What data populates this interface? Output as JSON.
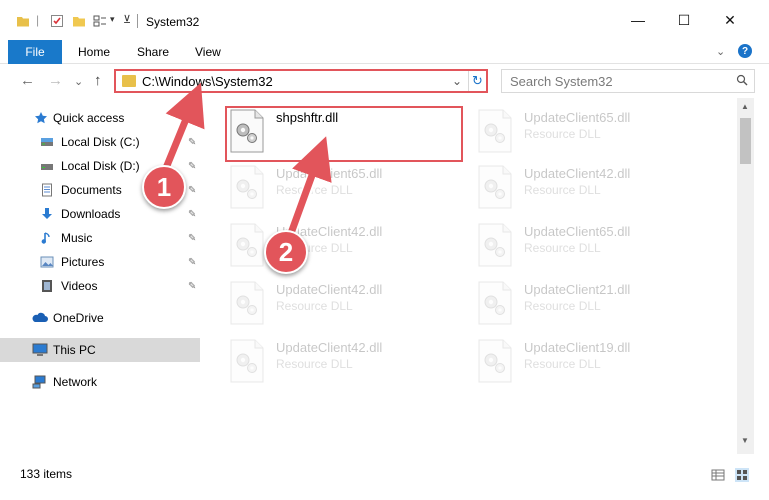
{
  "window": {
    "title": "System32",
    "controls": {
      "minimize": "—",
      "maximize": "☐",
      "close": "✕"
    }
  },
  "ribbon": {
    "file_tab": "File",
    "tabs": [
      "Home",
      "Share",
      "View"
    ],
    "expand": "⌄",
    "help": "?"
  },
  "nav": {
    "back": "←",
    "forward": "→",
    "recent": "⌄",
    "up": "↑",
    "address": "C:\\Windows\\System32",
    "address_chevron": "⌄",
    "refresh": "↻",
    "search_placeholder": "Search System32"
  },
  "sidebar": {
    "items": [
      {
        "label": "Quick access",
        "icon": "star-icon",
        "pinned": false
      },
      {
        "label": "Local Disk (C:)",
        "icon": "drive-icon",
        "pinned": true
      },
      {
        "label": "Local Disk (D:)",
        "icon": "drive-icon",
        "pinned": true
      },
      {
        "label": "Documents",
        "icon": "document-icon",
        "pinned": true
      },
      {
        "label": "Downloads",
        "icon": "download-icon",
        "pinned": true
      },
      {
        "label": "Music",
        "icon": "music-icon",
        "pinned": true
      },
      {
        "label": "Pictures",
        "icon": "pictures-icon",
        "pinned": true
      },
      {
        "label": "Videos",
        "icon": "video-icon",
        "pinned": true
      },
      {
        "label": "OneDrive",
        "icon": "cloud-icon",
        "pinned": false
      },
      {
        "label": "This PC",
        "icon": "computer-icon",
        "pinned": false,
        "selected": true
      },
      {
        "label": "Network",
        "icon": "network-icon",
        "pinned": false
      }
    ],
    "pin_glyph": "📌"
  },
  "files": [
    {
      "name": "shpshftr.dll",
      "type": "",
      "faded": false
    },
    {
      "name": "UpdateClient65.dll",
      "type": "Resource DLL",
      "faded": true
    },
    {
      "name": "UpdateClient65.dll",
      "type": "Resource DLL",
      "faded": true
    },
    {
      "name": "UpdateClient42.dll",
      "type": "Resource DLL",
      "faded": true
    },
    {
      "name": "UpdateClient42.dll",
      "type": "Resource DLL",
      "faded": true
    },
    {
      "name": "UpdateClient65.dll",
      "type": "Resource DLL",
      "faded": true
    },
    {
      "name": "UpdateClient42.dll",
      "type": "Resource DLL",
      "faded": true
    },
    {
      "name": "UpdateClient21.dll",
      "type": "Resource DLL",
      "faded": true
    },
    {
      "name": "UpdateClient42.dll",
      "type": "Resource DLL",
      "faded": true
    },
    {
      "name": "UpdateClient19.dll",
      "type": "Resource DLL",
      "faded": true
    }
  ],
  "status": {
    "item_count": "133 items"
  },
  "annotations": {
    "step1": "1",
    "step2": "2"
  },
  "colors": {
    "accent": "#1979ca",
    "annotation": "#e2555b",
    "folder": "#e8c04a"
  }
}
